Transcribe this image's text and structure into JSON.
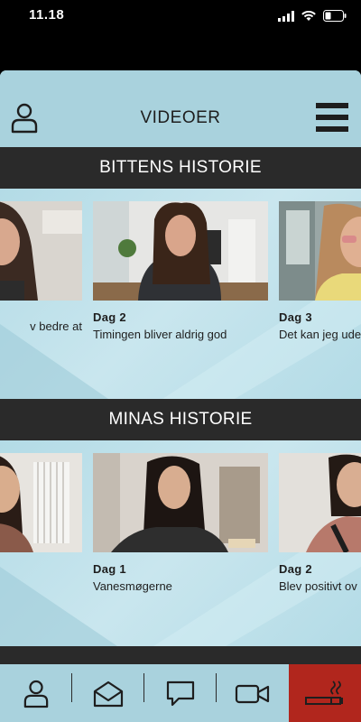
{
  "status": {
    "time": "11.18"
  },
  "header": {
    "title": "VIDEOER"
  },
  "sections": [
    {
      "title": "BITTENS HISTORIE",
      "videos": [
        {
          "day": "",
          "caption": "v bedre at"
        },
        {
          "day": "Dag 2",
          "caption": "Timingen bliver aldrig god"
        },
        {
          "day": "Dag 3",
          "caption": "Det kan jeg ude"
        }
      ]
    },
    {
      "title": "MINAS HISTORIE",
      "videos": [
        {
          "day": "",
          "caption": ""
        },
        {
          "day": "Dag 1",
          "caption": "Vanesmøgerne"
        },
        {
          "day": "Dag 2",
          "caption": "Blev positivt ov"
        }
      ]
    }
  ],
  "tabs": [
    {
      "icon": "person-icon"
    },
    {
      "icon": "envelope-icon"
    },
    {
      "icon": "chat-bubble-icon"
    },
    {
      "icon": "video-camera-icon"
    },
    {
      "icon": "cigarette-icon"
    }
  ],
  "colors": {
    "accent_active": "#b1261d",
    "background": "#a9d2dd",
    "bar": "#2a2a2a"
  }
}
